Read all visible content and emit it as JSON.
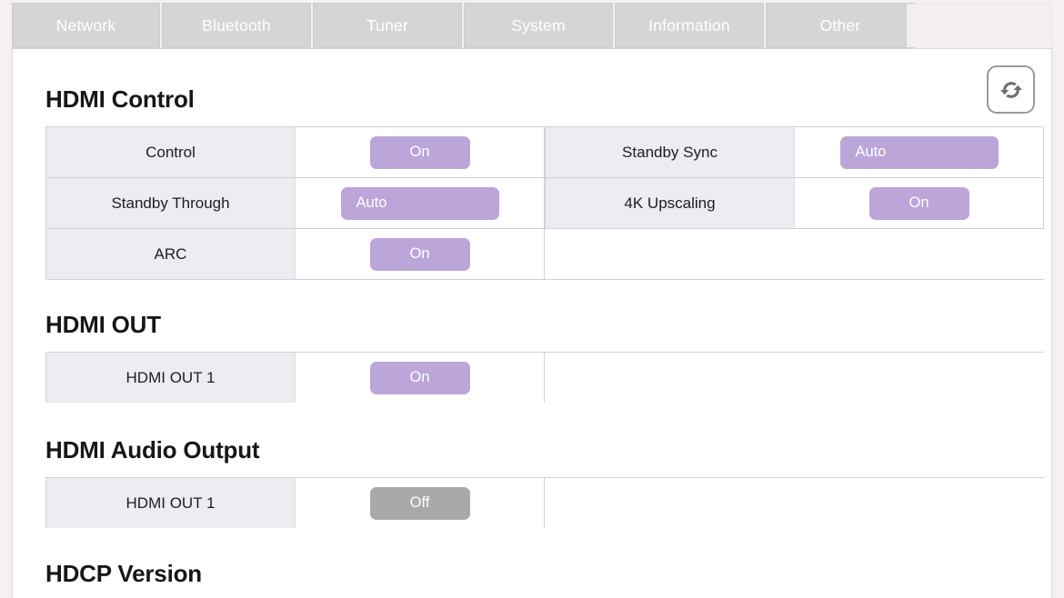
{
  "tabs": [
    {
      "label": "Network",
      "id": "network"
    },
    {
      "label": "Bluetooth",
      "id": "bluetooth"
    },
    {
      "label": "Tuner",
      "id": "tuner"
    },
    {
      "label": "System",
      "id": "system"
    },
    {
      "label": "Information",
      "id": "information"
    },
    {
      "label": "Other",
      "id": "other"
    }
  ],
  "toolbar": {
    "refresh_icon": "refresh-icon"
  },
  "sections": {
    "hdmi_control": {
      "title": "HDMI Control",
      "rows": [
        {
          "left": {
            "label": "Control",
            "value": "On",
            "state": "on"
          },
          "right": {
            "label": "Standby Sync",
            "value": "Auto",
            "state": "auto"
          }
        },
        {
          "left": {
            "label": "Standby Through",
            "value": "Auto",
            "state": "auto"
          },
          "right": {
            "label": "4K Upscaling",
            "value": "On",
            "state": "on"
          }
        },
        {
          "left": {
            "label": "ARC",
            "value": "On",
            "state": "on"
          },
          "right": null
        }
      ]
    },
    "hdmi_out": {
      "title": "HDMI OUT",
      "rows": [
        {
          "left": {
            "label": "HDMI OUT 1",
            "value": "On",
            "state": "on"
          },
          "right": null
        }
      ]
    },
    "hdmi_audio_output": {
      "title": "HDMI Audio Output",
      "rows": [
        {
          "left": {
            "label": "HDMI OUT 1",
            "value": "Off",
            "state": "off"
          },
          "right": null
        }
      ]
    },
    "hdcp_version": {
      "title": "HDCP Version"
    }
  },
  "colors": {
    "accent_purple": "#bca5d9",
    "off_gray": "#a9a9a9",
    "label_cell": "#ececf2",
    "tab_gray": "#d5d5d5",
    "page_bg": "#f5f0f3"
  }
}
